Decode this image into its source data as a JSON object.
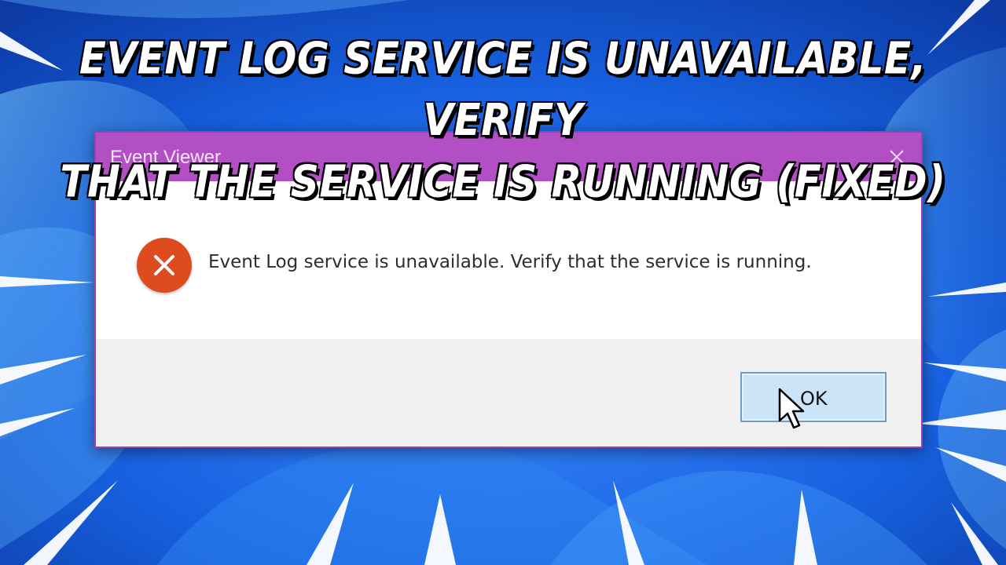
{
  "headline": {
    "line1": "EVENT LOG SERVICE IS UNAVAILABLE, VERIFY",
    "line2": "THAT THE SERVICE IS RUNNING (FIXED)"
  },
  "dialog": {
    "title": "Event Viewer",
    "message": "Event Log service is unavailable. Verify that the service is running.",
    "icon": "error-icon",
    "ok_label": "OK",
    "close_glyph": "×"
  },
  "colors": {
    "titlebar": "#b24fc4",
    "error_icon": "#dd4b1f",
    "ok_button": "#cce4f7",
    "background": "#1b63d8"
  }
}
